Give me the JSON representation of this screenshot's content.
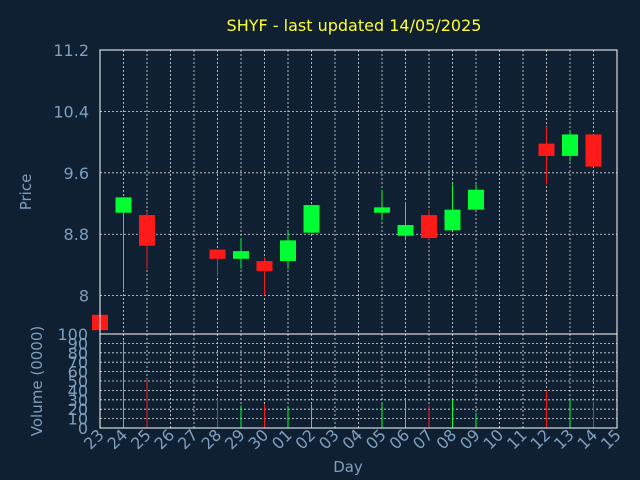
{
  "chart_data": {
    "type": "candlestick",
    "title": "SHYF - last updated 14/05/2025",
    "price_axis": {
      "ylabel": "Price",
      "ylim": [
        7.5,
        11.2
      ],
      "ticks": [
        8,
        8.8,
        9.6,
        10.4,
        11.2
      ],
      "tick_labels": [
        "8",
        "8.8",
        "9.6",
        "10.4",
        "11.2"
      ]
    },
    "volume_axis": {
      "ylabel": "Volume (0000)",
      "ylim": [
        0,
        100
      ],
      "ticks": [
        0,
        10,
        20,
        30,
        40,
        50,
        60,
        70,
        80,
        90,
        100
      ],
      "tick_labels": [
        "0",
        "10",
        "20",
        "30",
        "40",
        "50",
        "60",
        "70",
        "80",
        "90",
        "100"
      ]
    },
    "xlabel": "Day",
    "days": [
      "23",
      "24",
      "25",
      "26",
      "27",
      "28",
      "29",
      "30",
      "01",
      "02",
      "03",
      "04",
      "05",
      "06",
      "07",
      "08",
      "09",
      "10",
      "11",
      "12",
      "13",
      "14",
      "15"
    ],
    "grid": true,
    "up_color": "#00ff33",
    "down_color": "#ff1a1a",
    "candles": [
      {
        "day": "23",
        "open": 7.75,
        "high": 7.75,
        "low": 7.55,
        "close": 7.55,
        "volume": 0
      },
      {
        "day": "24",
        "open": 9.08,
        "high": 9.28,
        "low": 8.08,
        "close": 9.28,
        "volume": 93
      },
      {
        "day": "25",
        "open": 9.05,
        "high": 9.1,
        "low": 8.35,
        "close": 8.65,
        "volume": 52
      },
      {
        "day": "28",
        "open": 8.6,
        "high": 8.6,
        "low": 8.25,
        "close": 8.48,
        "volume": 31
      },
      {
        "day": "29",
        "open": 8.48,
        "high": 8.75,
        "low": 8.35,
        "close": 8.58,
        "volume": 24
      },
      {
        "day": "30",
        "open": 8.45,
        "high": 8.5,
        "low": 8.0,
        "close": 8.32,
        "volume": 25
      },
      {
        "day": "01",
        "open": 8.45,
        "high": 8.85,
        "low": 8.35,
        "close": 8.72,
        "volume": 23
      },
      {
        "day": "02",
        "open": 8.82,
        "high": 9.18,
        "low": 8.82,
        "close": 9.18,
        "volume": 25
      },
      {
        "day": "05",
        "open": 9.08,
        "high": 9.38,
        "low": 8.98,
        "close": 9.15,
        "volume": 27
      },
      {
        "day": "06",
        "open": 8.78,
        "high": 9.22,
        "low": 8.72,
        "close": 8.92,
        "volume": 31
      },
      {
        "day": "07",
        "open": 9.05,
        "high": 9.12,
        "low": 8.72,
        "close": 8.75,
        "volume": 24
      },
      {
        "day": "08",
        "open": 8.85,
        "high": 9.45,
        "low": 8.85,
        "close": 9.12,
        "volume": 30
      },
      {
        "day": "09",
        "open": 9.12,
        "high": 9.45,
        "low": 9.12,
        "close": 9.38,
        "volume": 16
      },
      {
        "day": "12",
        "open": 9.98,
        "high": 10.2,
        "low": 9.45,
        "close": 9.82,
        "volume": 40
      },
      {
        "day": "13",
        "open": 9.82,
        "high": 10.15,
        "low": 9.75,
        "close": 10.1,
        "volume": 30
      },
      {
        "day": "14",
        "open": 10.1,
        "high": 10.1,
        "low": 9.68,
        "close": 9.68,
        "volume": 28
      }
    ]
  }
}
